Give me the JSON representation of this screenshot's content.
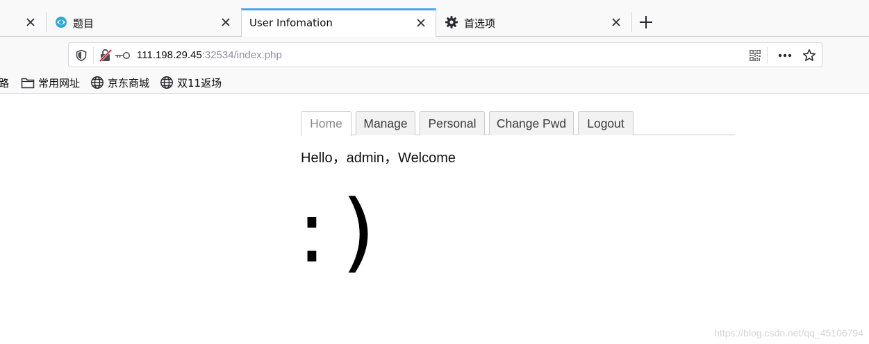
{
  "browser": {
    "tabs": [
      {
        "label": "",
        "selected": false
      },
      {
        "label": "题目",
        "icon": "site-favicon-icon",
        "selected": false
      },
      {
        "label": "User Infomation",
        "selected": true
      },
      {
        "label": "首选项",
        "icon": "gear-icon",
        "selected": false
      }
    ],
    "address": {
      "host": "111.198.29.45",
      "rest": ":32534/index.php"
    },
    "bookmarks": [
      {
        "label": "路",
        "icon": ""
      },
      {
        "label": "常用网址",
        "icon": "folder-icon"
      },
      {
        "label": "京东商城",
        "icon": "globe-icon"
      },
      {
        "label": "双11返场",
        "icon": "globe-icon"
      }
    ],
    "colors": {
      "selected_tab_accent": "#4aa3ec",
      "chrome_background": "#f9f9fa"
    }
  },
  "page": {
    "nav": [
      {
        "label": "Home",
        "active": true
      },
      {
        "label": "Manage",
        "active": false
      },
      {
        "label": "Personal",
        "active": false
      },
      {
        "label": "Change Pwd",
        "active": false
      },
      {
        "label": "Logout",
        "active": false
      }
    ],
    "greeting": "Hello，admin，Welcome",
    "smiley": ":)"
  },
  "watermark": "https://blog.csdn.net/qq_45106794"
}
